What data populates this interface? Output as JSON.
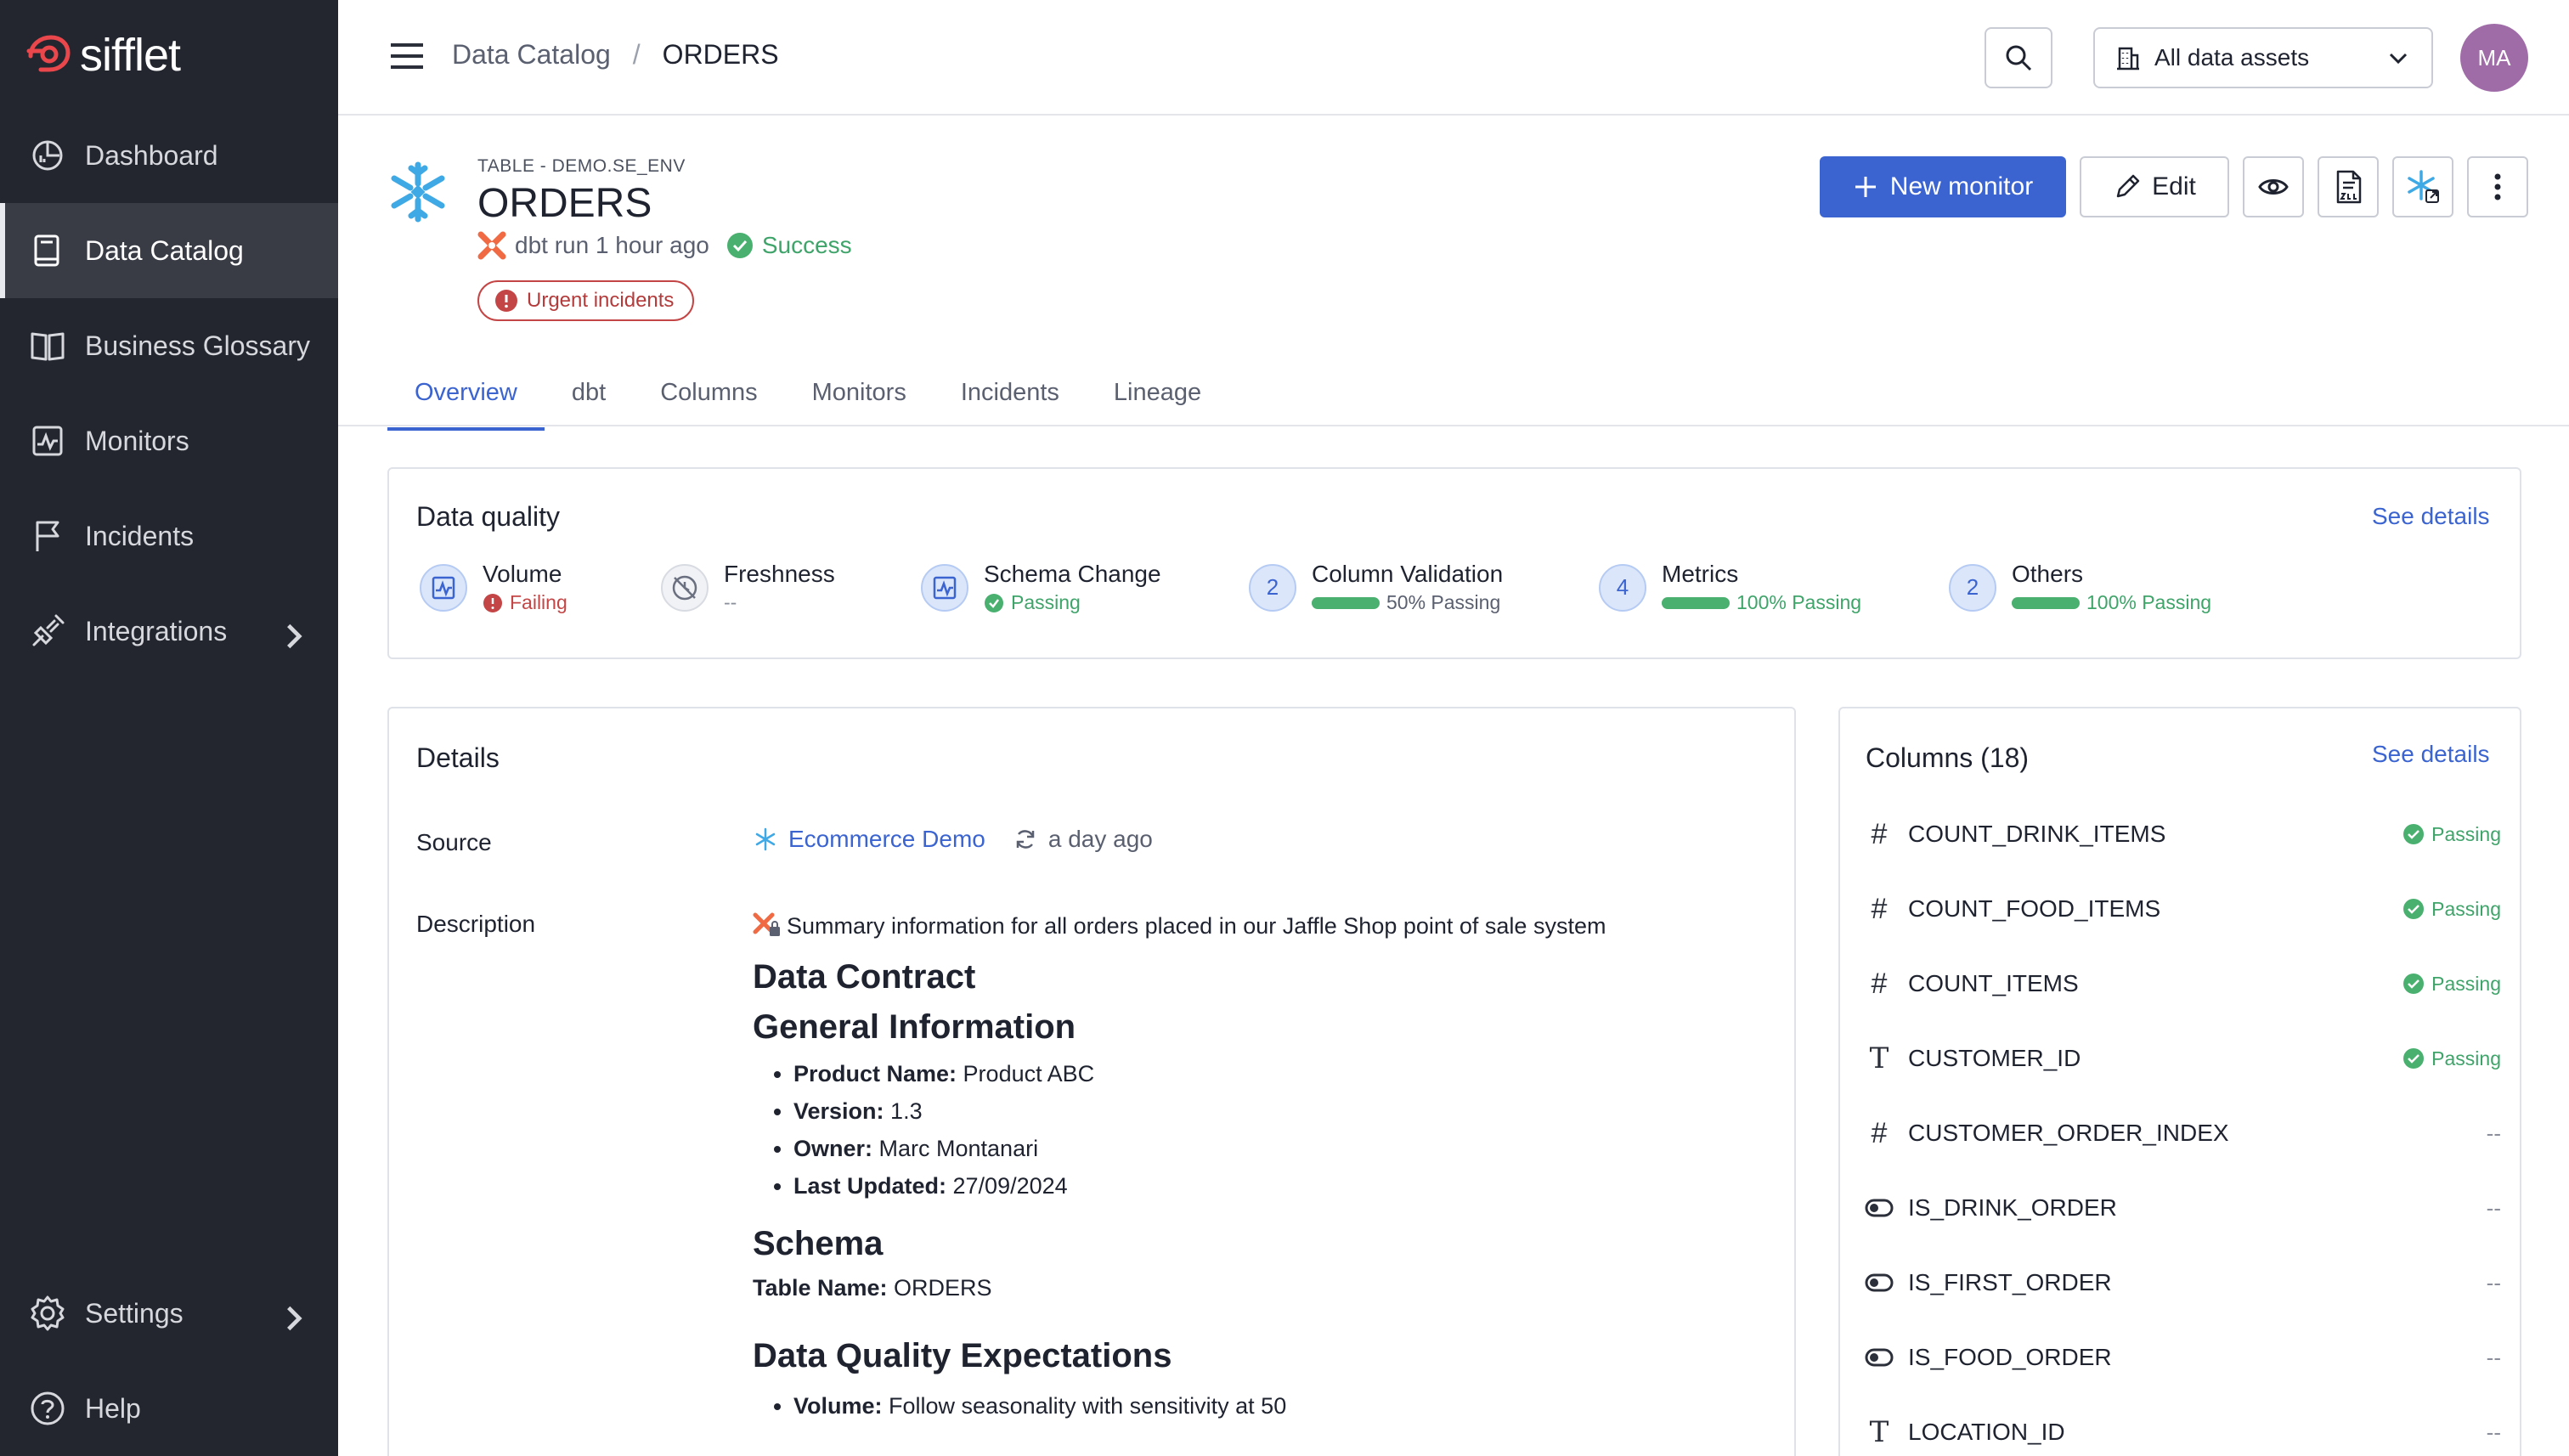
{
  "app": {
    "name": "sifflet"
  },
  "sidebar": {
    "items": [
      {
        "label": "Dashboard",
        "icon": "dashboard-icon"
      },
      {
        "label": "Data Catalog",
        "icon": "catalog-icon",
        "active": true
      },
      {
        "label": "Business Glossary",
        "icon": "book-icon"
      },
      {
        "label": "Monitors",
        "icon": "monitor-icon"
      },
      {
        "label": "Incidents",
        "icon": "flag-icon"
      },
      {
        "label": "Integrations",
        "icon": "plug-icon",
        "chevron": true
      }
    ],
    "bottom": [
      {
        "label": "Settings",
        "icon": "gear-icon",
        "chevron": true
      },
      {
        "label": "Help",
        "icon": "help-icon"
      }
    ]
  },
  "header": {
    "breadcrumb": [
      "Data Catalog",
      "/",
      "ORDERS"
    ],
    "asset_filter": "All data assets",
    "avatar_initials": "MA"
  },
  "asset": {
    "kind": "TABLE - DEMO.SE_ENV",
    "title": "ORDERS",
    "run_text": "dbt run 1 hour ago",
    "run_status": "Success",
    "urgent_badge": "Urgent incidents"
  },
  "actions": {
    "new_monitor": "New monitor",
    "edit": "Edit"
  },
  "tabs": [
    "Overview",
    "dbt",
    "Columns",
    "Monitors",
    "Incidents",
    "Lineage"
  ],
  "data_quality": {
    "title": "Data quality",
    "see_details": "See details",
    "items": [
      {
        "name": "Volume",
        "status": "Failing",
        "status_color": "#c44545"
      },
      {
        "name": "Freshness",
        "status": "--",
        "status_color": "#8a8f9b"
      },
      {
        "name": "Schema Change",
        "status": "Passing",
        "status_color": "#3fa46a"
      },
      {
        "name": "Column Validation",
        "count": "2",
        "status": "50% Passing",
        "status_color": "#5b6070"
      },
      {
        "name": "Metrics",
        "count": "4",
        "status": "100% Passing",
        "status_color": "#3fa46a"
      },
      {
        "name": "Others",
        "count": "2",
        "status": "100% Passing",
        "status_color": "#3fa46a"
      }
    ]
  },
  "details": {
    "title": "Details",
    "source_label": "Source",
    "source_value": "Ecommerce Demo",
    "source_time": "a day ago",
    "description_label": "Description",
    "description_text": "Summary information for all orders placed in our Jaffle Shop point of sale system",
    "h_contract": "Data Contract",
    "h_general": "General Information",
    "general": [
      {
        "k": "Product Name:",
        "v": " Product ABC"
      },
      {
        "k": "Version:",
        "v": " 1.3"
      },
      {
        "k": "Owner:",
        "v": " Marc Montanari"
      },
      {
        "k": "Last Updated:",
        "v": " 27/09/2024"
      }
    ],
    "h_schema": "Schema",
    "table_name_label": "Table Name:",
    "table_name_value": " ORDERS",
    "h_dq": "Data Quality Expectations",
    "dq_first_label": "Volume:",
    "dq_first_value": " Follow seasonality with sensitivity at 50"
  },
  "columns": {
    "title": "Columns (18)",
    "see_details": "See details",
    "rows": [
      {
        "type": "#",
        "name": "COUNT_DRINK_ITEMS",
        "status": "Passing"
      },
      {
        "type": "#",
        "name": "COUNT_FOOD_ITEMS",
        "status": "Passing"
      },
      {
        "type": "#",
        "name": "COUNT_ITEMS",
        "status": "Passing"
      },
      {
        "type": "T",
        "name": "CUSTOMER_ID",
        "status": "Passing"
      },
      {
        "type": "#",
        "name": "CUSTOMER_ORDER_INDEX",
        "status": "--"
      },
      {
        "type": "toggle",
        "name": "IS_DRINK_ORDER",
        "status": "--"
      },
      {
        "type": "toggle",
        "name": "IS_FIRST_ORDER",
        "status": "--"
      },
      {
        "type": "toggle",
        "name": "IS_FOOD_ORDER",
        "status": "--"
      },
      {
        "type": "T",
        "name": "LOCATION_ID",
        "status": "--"
      }
    ]
  }
}
